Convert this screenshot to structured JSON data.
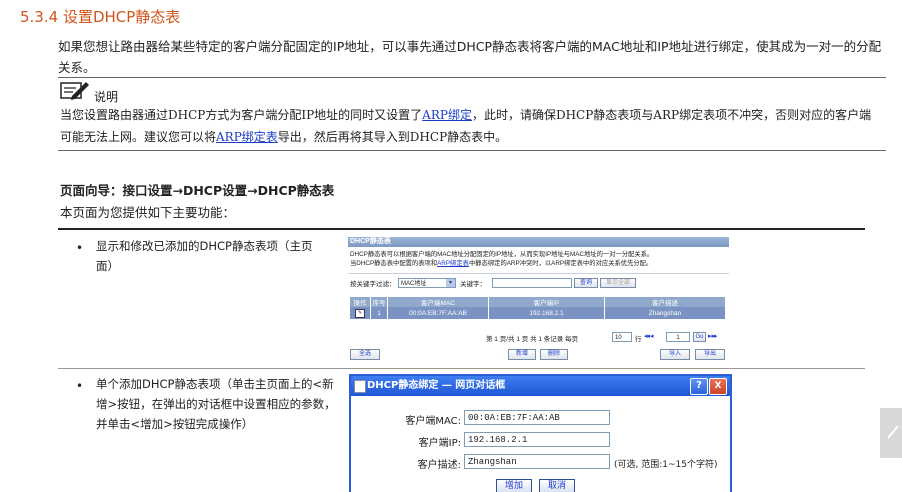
{
  "section": {
    "number": "5.3.4",
    "title": "设置DHCP静态表"
  },
  "paragraph": "如果您想让路由器给某些特定的客户端分配固定的IP地址，可以事先通过DHCP静态表将客户端的MAC地址和IP地址进行绑定，使其成为一对一的分配关系。",
  "note": {
    "label": "说明",
    "text_1": "当您设置路由器通过DHCP方式为客户端分配IP地址的同时又设置了",
    "link_1": "ARP绑定",
    "text_2": "，此时，请确保DHCP静态表项与ARP绑定表项不冲突，否则对应的客户端可能无法上网。建议您可以将",
    "link_2": "ARP绑定表",
    "text_3": "导出，然后再将其导入到DHCP静态表中。"
  },
  "guide": "页面向导：接口设置→DHCP设置→DHCP静态表",
  "intro": "本页面为您提供如下主要功能：",
  "rows": [
    {
      "bullet": "•",
      "text": "显示和修改已添加的DHCP静态表项（主页面）"
    },
    {
      "bullet": "•",
      "text": "单个添加DHCP静态表项（单击主页面上的<新增>按钮，在弹出的对话框中设置相应的参数，并单击<增加>按钮完成操作）"
    }
  ],
  "screenshot_main": {
    "header": "DHCP静态表",
    "desc_1": "DHCP静态表可以根据客户端的MAC地址分配固定的IP地址，从而实现IP地址与MAC地址的一对一分配关系。",
    "desc_2a": "当DHCP静态表中配置的表项和",
    "desc_link": "ARP绑定表",
    "desc_2b": "中静态绑定的ARP冲突时，以ARP绑定表中的对应关系优先分配。",
    "filter_label": "按关键字过滤：",
    "filter_select": "MAC地址",
    "keyword_label": "关键字：",
    "query_btn": "查询",
    "show_all_btn": "显示全部",
    "columns": [
      "操作",
      "序号",
      "客户端MAC",
      "客户端IP",
      "客户描述"
    ],
    "row": {
      "index": "1",
      "mac": "00:0A:EB:7F:AA:AB",
      "ip": "192.168.2.1",
      "desc": "Zhangshan"
    },
    "pager": "第 1 页/共 1 页 共 1 条记录 每页",
    "per_page": "10",
    "per_page_suffix": "行",
    "page_input": "1",
    "go_btn": "Go",
    "select_all_btn": "全选",
    "add_btn": "新增",
    "delete_btn": "删除",
    "import_btn": "导入",
    "export_btn": "导出"
  },
  "dialog": {
    "title": "DHCP静态绑定 — 网页对话框",
    "help": "?",
    "close": "X",
    "mac_label": "客户端MAC:",
    "mac_value": "00:0A:EB:7F:AA:AB",
    "ip_label": "客户端IP:",
    "ip_value": "192.168.2.1",
    "desc_label": "客户描述:",
    "desc_value": "Zhangshan",
    "desc_hint": "(可选, 范围:1~15个字符)",
    "add_btn": "增加",
    "cancel_btn": "取消"
  }
}
